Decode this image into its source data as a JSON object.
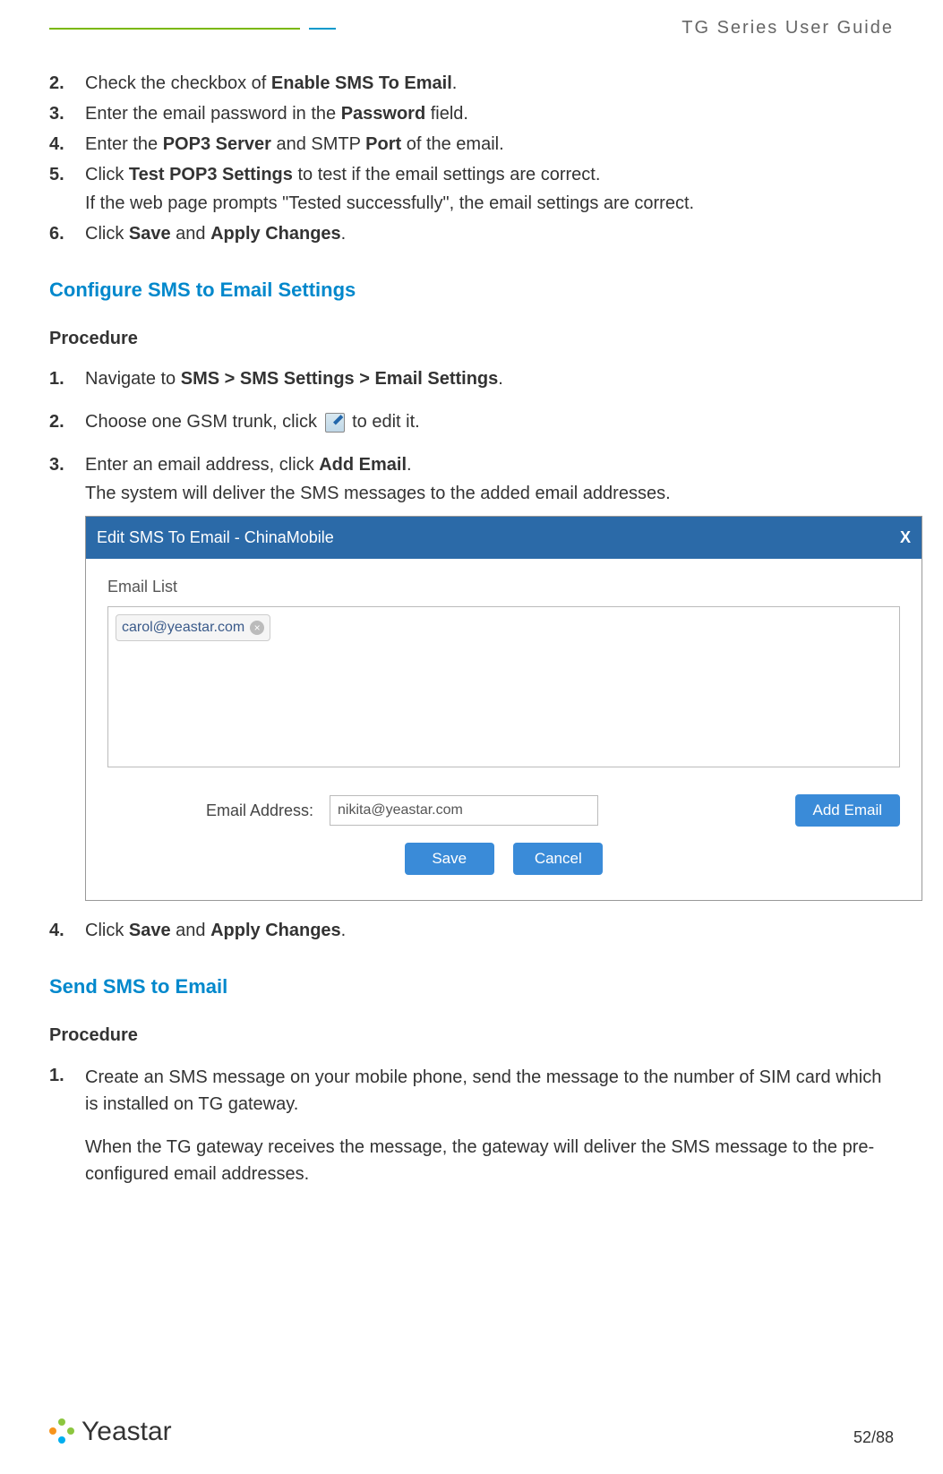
{
  "header": {
    "title": "TG  Series  User  Guide"
  },
  "top_steps": [
    {
      "num": "2.",
      "parts": [
        "Check the checkbox of ",
        "Enable SMS To Email",
        "."
      ]
    },
    {
      "num": "3.",
      "parts": [
        "Enter the email password in the ",
        "Password",
        " field."
      ]
    },
    {
      "num": "4.",
      "parts": [
        "Enter the ",
        "POP3 Server",
        " and SMTP ",
        "Port",
        " of the email."
      ]
    },
    {
      "num": "5.",
      "parts": [
        "Click ",
        "Test POP3 Settings",
        " to test if the email settings are correct."
      ],
      "sub": "If the web page prompts \"Tested successfully\", the email settings are correct."
    },
    {
      "num": "6.",
      "parts": [
        "Click ",
        "Save",
        " and ",
        "Apply Changes",
        "."
      ]
    }
  ],
  "section1": {
    "title": "Configure SMS to Email Settings",
    "procedure_label": "Procedure",
    "steps": {
      "s1": {
        "num": "1.",
        "pre": "Navigate to ",
        "bold": "SMS > SMS Settings > Email Settings",
        "post": "."
      },
      "s2": {
        "num": "2.",
        "pre": "Choose one GSM trunk, click ",
        "post": " to edit it."
      },
      "s3": {
        "num": "3.",
        "pre": "Enter an email address, click ",
        "bold": "Add Email",
        "post": ".",
        "sub": "The system will deliver the SMS messages to the added email addresses."
      }
    }
  },
  "dialog": {
    "title": "Edit SMS To Email - ChinaMobile",
    "close": "X",
    "email_list_label": "Email List",
    "email_tag": "carol@yeastar.com",
    "email_address_label": "Email Address:",
    "email_address_value": "nikita@yeastar.com",
    "add_email_btn": "Add Email",
    "save_btn": "Save",
    "cancel_btn": "Cancel"
  },
  "step4": {
    "num": "4.",
    "parts": [
      "Click ",
      "Save",
      " and ",
      "Apply Changes",
      "."
    ]
  },
  "section2": {
    "title": "Send SMS to Email",
    "procedure_label": "Procedure",
    "s1": {
      "num": "1.",
      "p1": "Create an SMS message on your mobile phone, send the message to the number of SIM card which is installed on TG gateway.",
      "p2": "When the TG gateway receives the message, the gateway will deliver the SMS message to the pre-configured email addresses."
    }
  },
  "footer": {
    "brand": "Yeastar",
    "page": "52/88"
  }
}
